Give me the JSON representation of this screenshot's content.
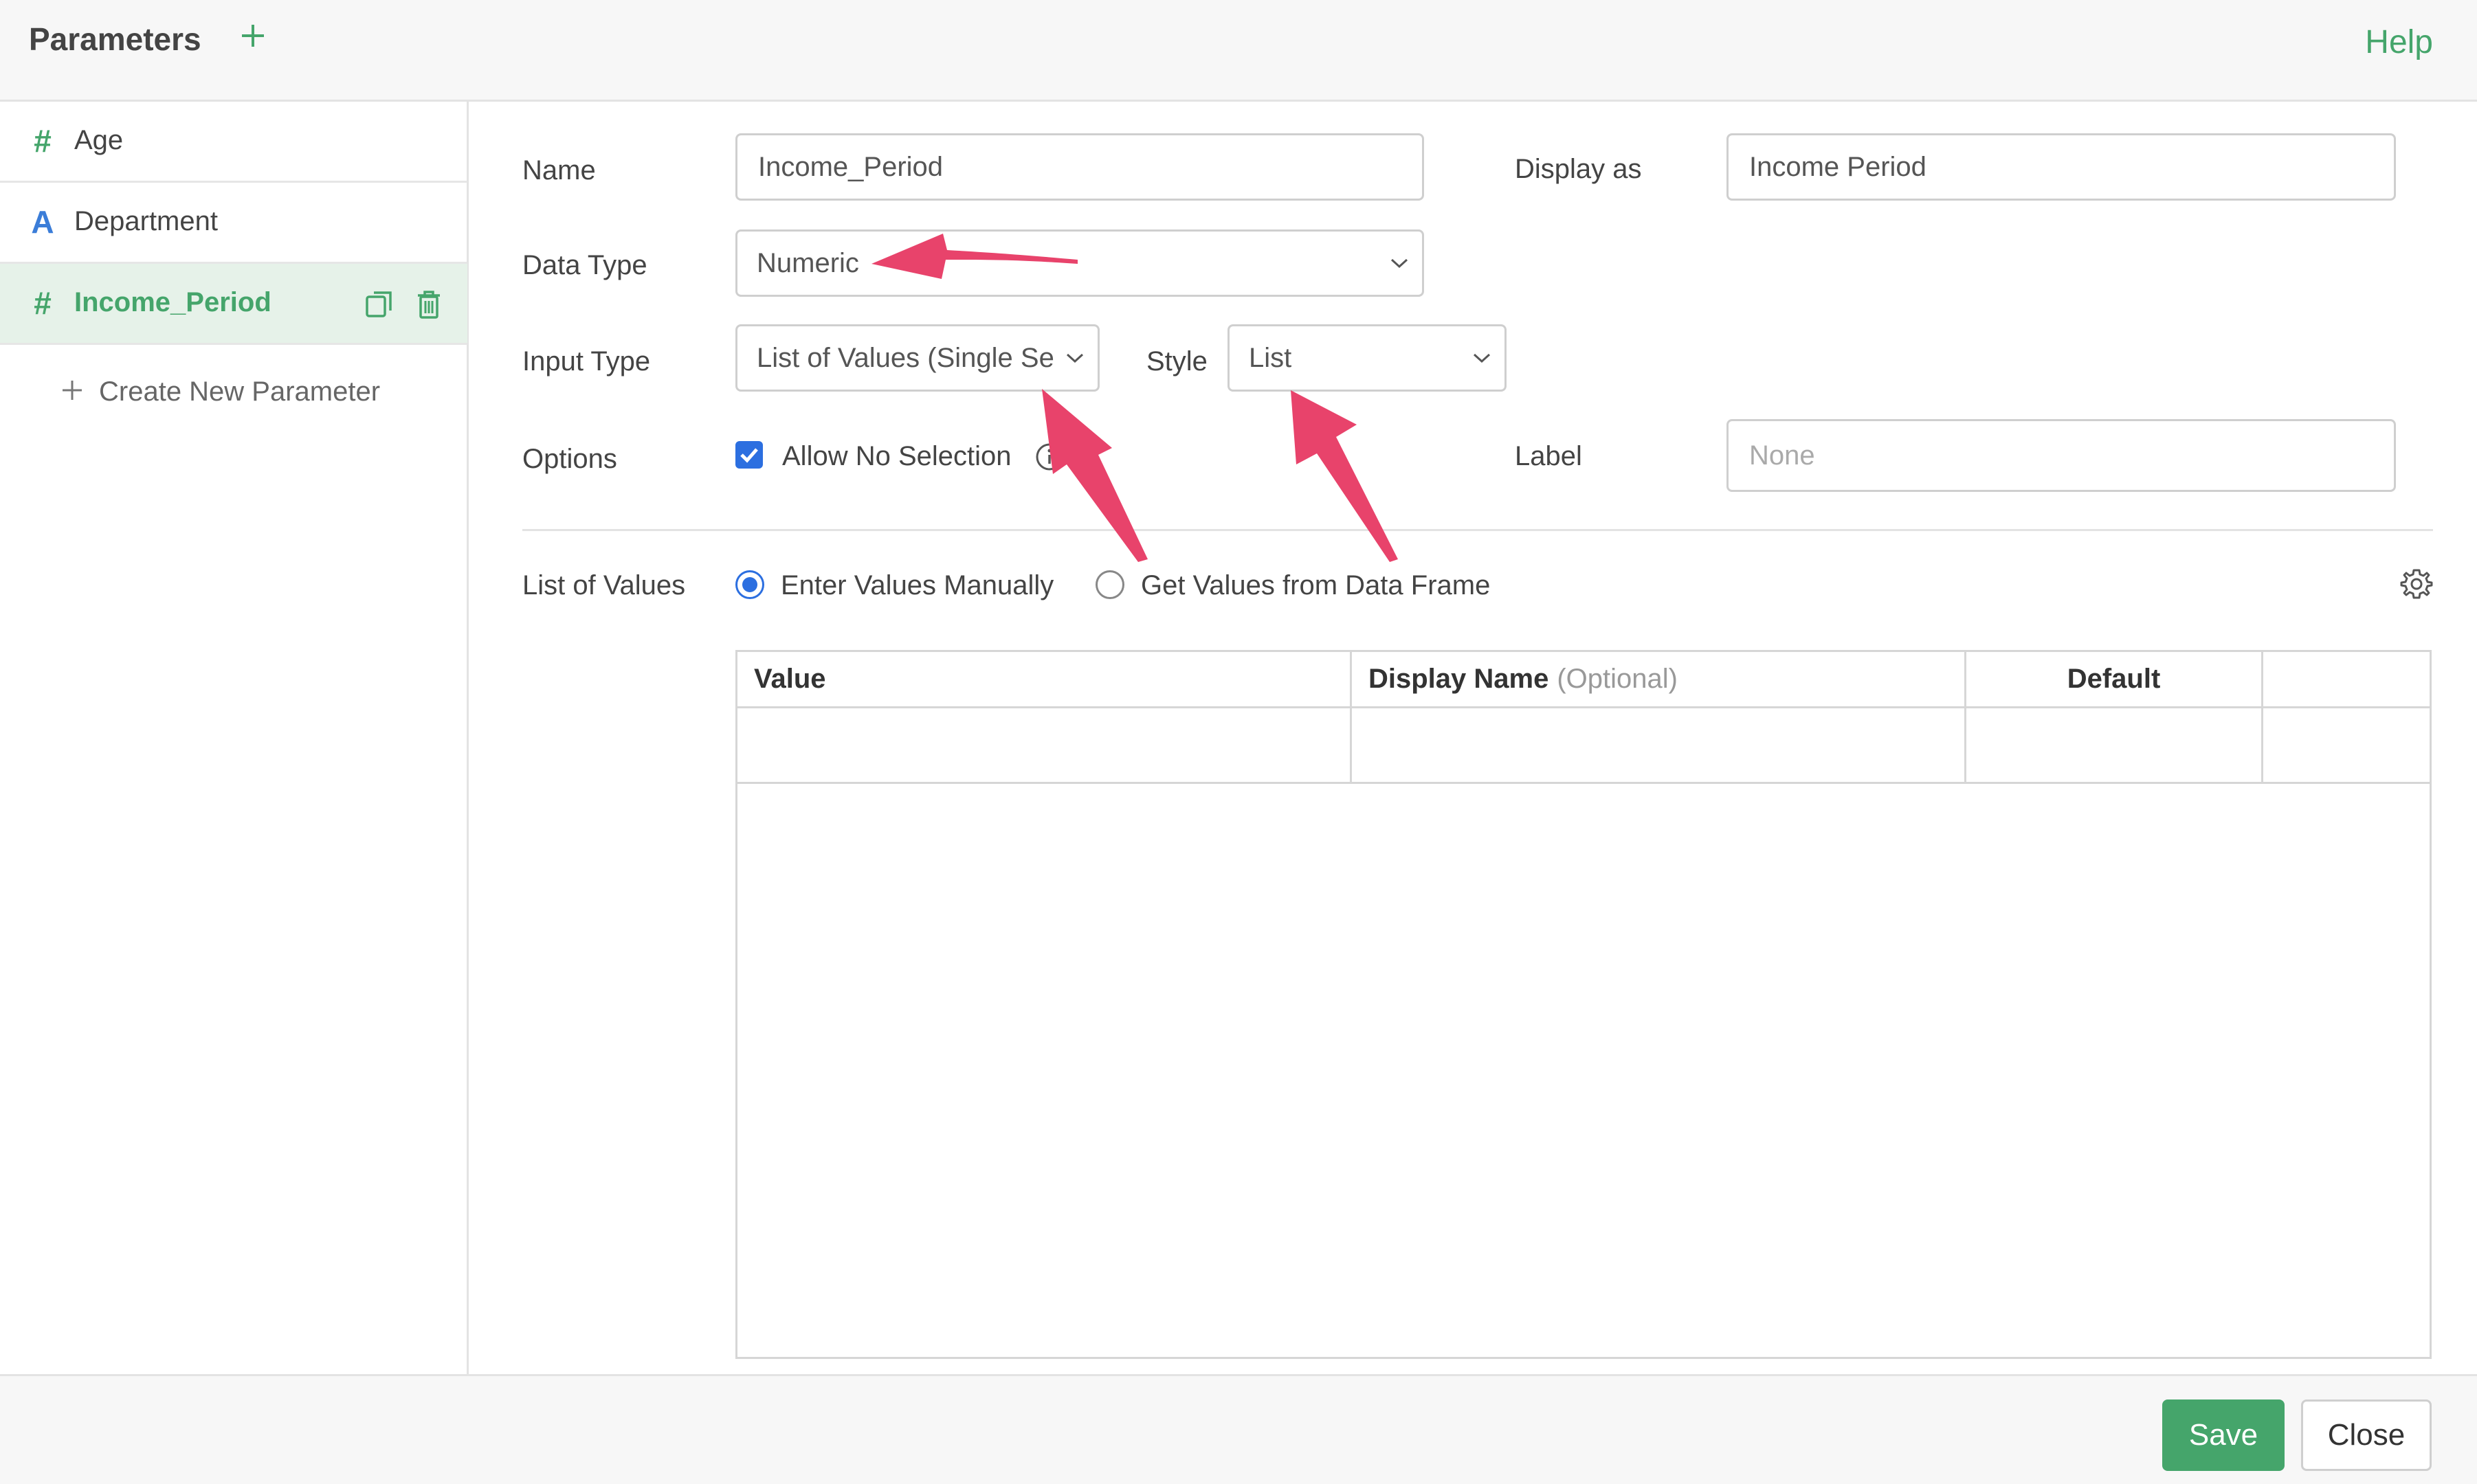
{
  "header": {
    "title": "Parameters",
    "help": "Help"
  },
  "sidebar": {
    "items": [
      {
        "icon": "#",
        "label": "Age"
      },
      {
        "icon": "A",
        "label": "Department"
      },
      {
        "icon": "#",
        "label": "Income_Period"
      }
    ],
    "create_new": "Create New Parameter"
  },
  "form": {
    "name_label": "Name",
    "name_value": "Income_Period",
    "display_as_label": "Display as",
    "display_as_value": "Income Period",
    "data_type_label": "Data Type",
    "data_type_value": "Numeric",
    "input_type_label": "Input Type",
    "input_type_value": "List of Values (Single Se",
    "style_label": "Style",
    "style_value": "List",
    "options_label": "Options",
    "allow_no_selection": "Allow No Selection",
    "label_label": "Label",
    "label_placeholder": "None",
    "list_of_values_label": "List of Values",
    "radio_manual": "Enter Values Manually",
    "radio_data_frame": "Get Values from Data Frame"
  },
  "table": {
    "col_value": "Value",
    "col_display_name": "Display Name",
    "col_display_name_hint": "(Optional)",
    "col_default": "Default"
  },
  "footer": {
    "save": "Save",
    "close": "Close"
  },
  "colors": {
    "accent_green": "#45a56b",
    "checkbox_blue": "#2c6fe0",
    "arrow_pink": "#e8436b",
    "icon_blue": "#3b7dd8"
  }
}
